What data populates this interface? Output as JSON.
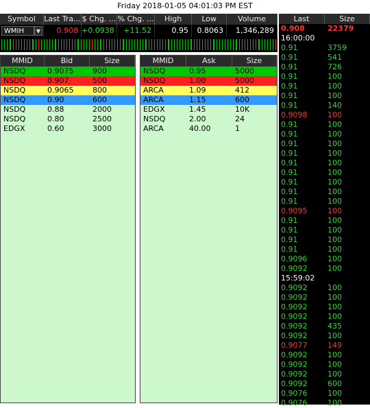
{
  "title": "Friday 2018-01-05 04:01:03 PM EST",
  "quote": {
    "headers": [
      "Symbol",
      "Last Tra...",
      "$ Chg. ...",
      "% Chg. ...",
      "High",
      "Low",
      "Volume"
    ],
    "symbol": "WMIH",
    "last": "0.908",
    "chg": "+0.0938",
    "pct": "+11.52",
    "high": "0.95",
    "low": "0.8063",
    "volume": "1,346,289"
  },
  "colors": {
    "green": "#00c800",
    "red": "#ff2020",
    "yellow": "#ffff60",
    "blue": "#3399ff",
    "book_bg": "#cdf8cd",
    "ts_green": "#22dd22",
    "ts_red": "#ff3030"
  },
  "strip": [
    "g",
    "g",
    "g",
    "g",
    "g",
    "g",
    "g",
    "g",
    "g",
    "g",
    "g",
    "g",
    "g",
    "r",
    "g",
    "g",
    "g",
    "g",
    "g",
    "g",
    "g",
    "g",
    "g",
    "g",
    "g",
    "g",
    "g",
    "g",
    "g",
    "g",
    "g",
    "g",
    "r",
    "g",
    "g",
    "g",
    "g",
    "g",
    "g",
    "g",
    "g",
    "g",
    "g",
    "g",
    "g",
    "g",
    "g",
    "g",
    "g",
    "g",
    "g",
    "g",
    "g",
    "g",
    "g",
    "g",
    "g",
    "g",
    "g",
    "g",
    "g",
    "g",
    "g",
    "g",
    "g",
    "g",
    "g",
    "g",
    "g",
    "g",
    "g",
    "g",
    "g",
    "g",
    "g",
    "g",
    "g",
    "g",
    "g",
    "g",
    "g",
    "g",
    "g",
    "g",
    "g",
    "g",
    "g",
    "g",
    "g",
    "g",
    "g",
    "g",
    "g",
    "g",
    "g",
    "g",
    "g",
    "r"
  ],
  "bid_book": {
    "headers": [
      "MMID",
      "Bid",
      "Size"
    ],
    "rows": [
      {
        "mmid": "NSDQ",
        "price": "0.9075",
        "size": "900",
        "level": "green"
      },
      {
        "mmid": "NSDQ",
        "price": "0.907",
        "size": "500",
        "level": "red"
      },
      {
        "mmid": "NSDQ",
        "price": "0.9065",
        "size": "800",
        "level": "yellow"
      },
      {
        "mmid": "NSDQ",
        "price": "0.90",
        "size": "600",
        "level": "blue"
      },
      {
        "mmid": "NSDQ",
        "price": "0.88",
        "size": "2000",
        "level": "none"
      },
      {
        "mmid": "NSDQ",
        "price": "0.80",
        "size": "2500",
        "level": "none"
      },
      {
        "mmid": "EDGX",
        "price": "0.60",
        "size": "3000",
        "level": "none"
      }
    ]
  },
  "ask_book": {
    "headers": [
      "MMID",
      "Ask",
      "Size"
    ],
    "rows": [
      {
        "mmid": "NSDQ",
        "price": "0.95",
        "size": "5000",
        "level": "green"
      },
      {
        "mmid": "NSDQ",
        "price": "1.00",
        "size": "5000",
        "level": "red"
      },
      {
        "mmid": "ARCA",
        "price": "1.09",
        "size": "412",
        "level": "yellow"
      },
      {
        "mmid": "ARCA",
        "price": "1.15",
        "size": "600",
        "level": "blue"
      },
      {
        "mmid": "EDGX",
        "price": "1.45",
        "size": "10K",
        "level": "none"
      },
      {
        "mmid": "NSDQ",
        "price": "2.00",
        "size": "24",
        "level": "none"
      },
      {
        "mmid": "ARCA",
        "price": "40.00",
        "size": "1",
        "level": "none"
      }
    ]
  },
  "time_sales": {
    "headers": [
      "Last",
      "Size"
    ],
    "rows": [
      {
        "p": "0.908",
        "s": "22379",
        "c": "red",
        "bold": true
      },
      {
        "time": "16:00:00"
      },
      {
        "p": "0.91",
        "s": "3759",
        "c": "green"
      },
      {
        "p": "0.91",
        "s": "541",
        "c": "green"
      },
      {
        "p": "0.91",
        "s": "726",
        "c": "green"
      },
      {
        "p": "0.91",
        "s": "100",
        "c": "green"
      },
      {
        "p": "0.91",
        "s": "100",
        "c": "green"
      },
      {
        "p": "0.91",
        "s": "100",
        "c": "green"
      },
      {
        "p": "0.91",
        "s": "140",
        "c": "green"
      },
      {
        "p": "0.9098",
        "s": "100",
        "c": "red"
      },
      {
        "p": "0.91",
        "s": "100",
        "c": "green"
      },
      {
        "p": "0.91",
        "s": "100",
        "c": "green"
      },
      {
        "p": "0.91",
        "s": "100",
        "c": "green"
      },
      {
        "p": "0.91",
        "s": "100",
        "c": "green"
      },
      {
        "p": "0.91",
        "s": "100",
        "c": "green"
      },
      {
        "p": "0.91",
        "s": "100",
        "c": "green"
      },
      {
        "p": "0.91",
        "s": "100",
        "c": "green"
      },
      {
        "p": "0.91",
        "s": "100",
        "c": "green"
      },
      {
        "p": "0.91",
        "s": "100",
        "c": "green"
      },
      {
        "p": "0.9095",
        "s": "100",
        "c": "red"
      },
      {
        "p": "0.91",
        "s": "100",
        "c": "green"
      },
      {
        "p": "0.91",
        "s": "100",
        "c": "green"
      },
      {
        "p": "0.91",
        "s": "100",
        "c": "green"
      },
      {
        "p": "0.91",
        "s": "100",
        "c": "green"
      },
      {
        "p": "0.9096",
        "s": "100",
        "c": "green"
      },
      {
        "p": "0.9092",
        "s": "100",
        "c": "green"
      },
      {
        "time": "15:59:02"
      },
      {
        "p": "0.9092",
        "s": "100",
        "c": "green"
      },
      {
        "p": "0.9092",
        "s": "100",
        "c": "green"
      },
      {
        "p": "0.9092",
        "s": "100",
        "c": "green"
      },
      {
        "p": "0.9092",
        "s": "100",
        "c": "green"
      },
      {
        "p": "0.9092",
        "s": "435",
        "c": "green"
      },
      {
        "p": "0.9092",
        "s": "100",
        "c": "green"
      },
      {
        "p": "0.9077",
        "s": "149",
        "c": "red"
      },
      {
        "p": "0.9092",
        "s": "100",
        "c": "green"
      },
      {
        "p": "0.9092",
        "s": "100",
        "c": "green"
      },
      {
        "p": "0.9092",
        "s": "100",
        "c": "green"
      },
      {
        "p": "0.9092",
        "s": "600",
        "c": "green"
      },
      {
        "p": "0.9076",
        "s": "100",
        "c": "green"
      },
      {
        "p": "0.9076",
        "s": "100",
        "c": "green"
      }
    ]
  }
}
